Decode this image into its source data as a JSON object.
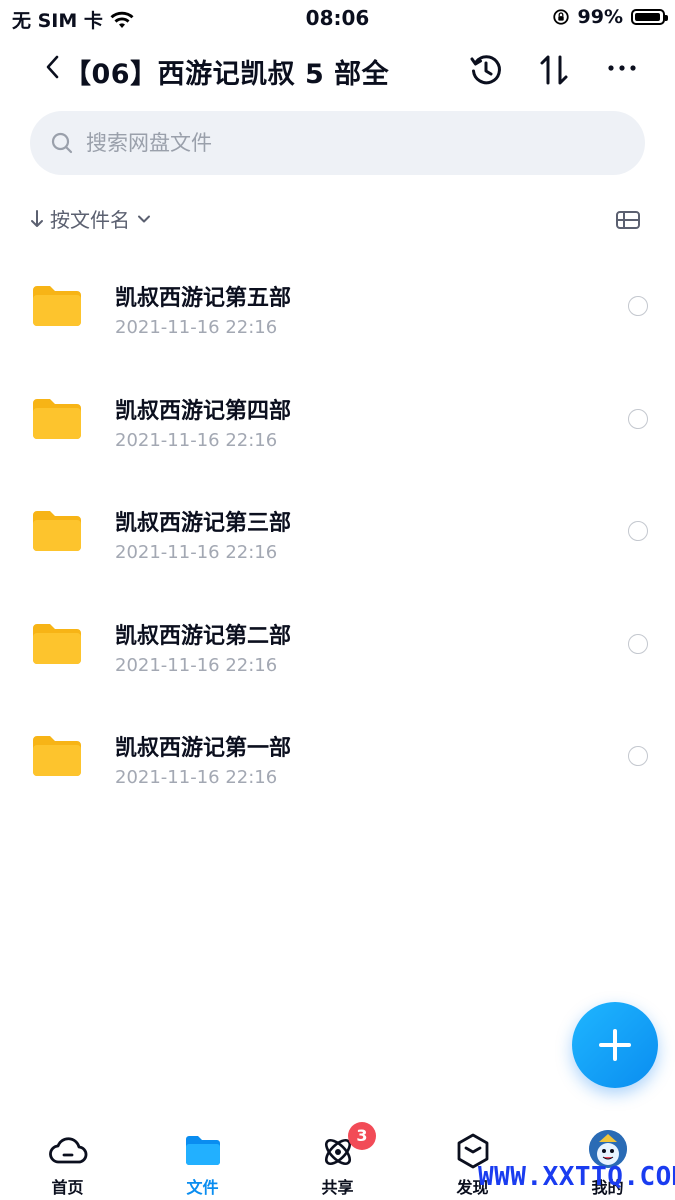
{
  "status_bar": {
    "carrier": "无 SIM 卡",
    "time": "08:06",
    "battery_percent": "99%",
    "battery_level": 0.99,
    "icons": [
      "wifi-icon",
      "rotation-lock-icon",
      "battery-icon"
    ]
  },
  "nav": {
    "title": "【06】西游记凯叔 5 部全",
    "icons": [
      "back-icon",
      "history-icon",
      "sort-icon",
      "more-icon"
    ]
  },
  "search": {
    "placeholder": "搜索网盘文件"
  },
  "sort": {
    "label": "按文件名"
  },
  "files": [
    {
      "name": "凯叔西游记第五部",
      "date": "2021-11-16 22:16"
    },
    {
      "name": "凯叔西游记第四部",
      "date": "2021-11-16 22:16"
    },
    {
      "name": "凯叔西游记第三部",
      "date": "2021-11-16 22:16"
    },
    {
      "name": "凯叔西游记第二部",
      "date": "2021-11-16 22:16"
    },
    {
      "name": "凯叔西游记第一部",
      "date": "2021-11-16 22:16"
    }
  ],
  "tabs": [
    {
      "label": "首页",
      "icon": "cloud-icon"
    },
    {
      "label": "文件",
      "icon": "folder-icon",
      "active": true
    },
    {
      "label": "共享",
      "icon": "share-icon",
      "badge": "3"
    },
    {
      "label": "发现",
      "icon": "discover-icon"
    },
    {
      "label": "我的",
      "icon": "avatar-icon"
    }
  ],
  "watermark": "WWW.XXTTQ.COM",
  "colors": {
    "accent": "#0a8df0",
    "folder": "#fdc42d",
    "badge": "#f24b57",
    "watermark": "#1a3cf0"
  }
}
